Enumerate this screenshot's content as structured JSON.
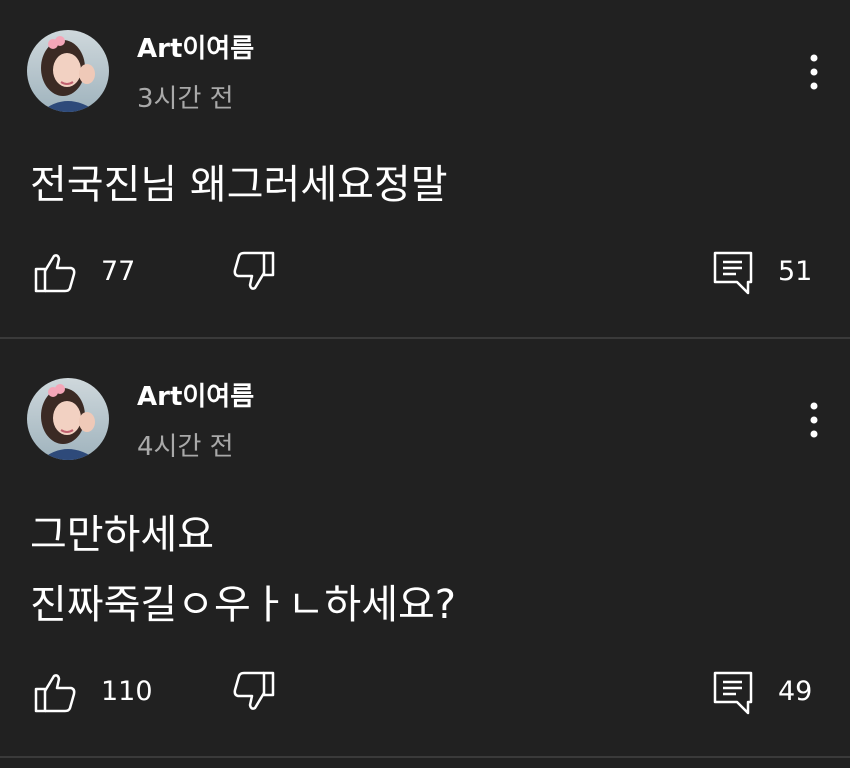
{
  "comments": [
    {
      "author": "Art이여름",
      "time": "3시간 전",
      "text": "전국진님 왜그러세요정말",
      "likes": "77",
      "replies": "51"
    },
    {
      "author": "Art이여름",
      "time": "4시간 전",
      "text": "그만하세요\n진짜죽길ㅇ우ㅏㄴ하세요?",
      "likes": "110",
      "replies": "49"
    }
  ],
  "icons": {
    "like": "thumb-up-outline-icon",
    "dislike": "thumb-down-outline-icon",
    "reply": "comment-reply-icon",
    "more": "more-vertical-icon"
  },
  "colors": {
    "background": "#212121",
    "text": "#ffffff",
    "secondary_text": "#a9a9a9",
    "divider": "#3a3a3a"
  }
}
